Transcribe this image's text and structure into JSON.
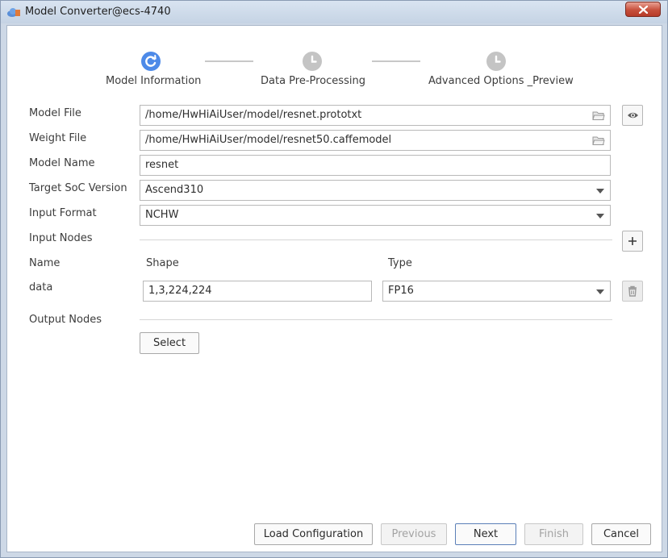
{
  "window": {
    "title": "Model Converter@ecs-4740",
    "icons": {
      "app": "app-cloud-icon",
      "close": "close-icon"
    }
  },
  "steps": [
    {
      "label": "Model Information",
      "state": "active",
      "icon": "progress-icon"
    },
    {
      "label": "Data Pre-Processing",
      "state": "pending",
      "icon": "clock-icon"
    },
    {
      "label": "Advanced Options _Preview",
      "state": "pending",
      "icon": "clock-icon"
    }
  ],
  "colors": {
    "active_step": "#4d8ae8",
    "pending_step": "#c4c4c4"
  },
  "form": {
    "model_file": {
      "label": "Model File",
      "value": "/home/HwHiAiUser/model/resnet.prototxt",
      "icon": "folder-icon",
      "preview_icon": "eye-icon"
    },
    "weight_file": {
      "label": "Weight File",
      "value": "/home/HwHiAiUser/model/resnet50.caffemodel",
      "icon": "folder-icon"
    },
    "model_name": {
      "label": "Model Name",
      "value": "resnet"
    },
    "target_soc": {
      "label": "Target SoC Version",
      "value": "Ascend310"
    },
    "input_format": {
      "label": "Input Format",
      "value": "NCHW"
    },
    "input_nodes": {
      "label": "Input Nodes",
      "add_icon": "plus-icon",
      "columns": {
        "name": "Name",
        "shape": "Shape",
        "type": "Type"
      },
      "rows": [
        {
          "name": "data",
          "shape": "1,3,224,224",
          "type": "FP16",
          "delete_icon": "trash-icon"
        }
      ]
    },
    "output_nodes": {
      "label": "Output Nodes",
      "select_label": "Select"
    }
  },
  "footer": {
    "load_configuration": "Load Configuration",
    "previous": "Previous",
    "next": "Next",
    "finish": "Finish",
    "cancel": "Cancel"
  }
}
